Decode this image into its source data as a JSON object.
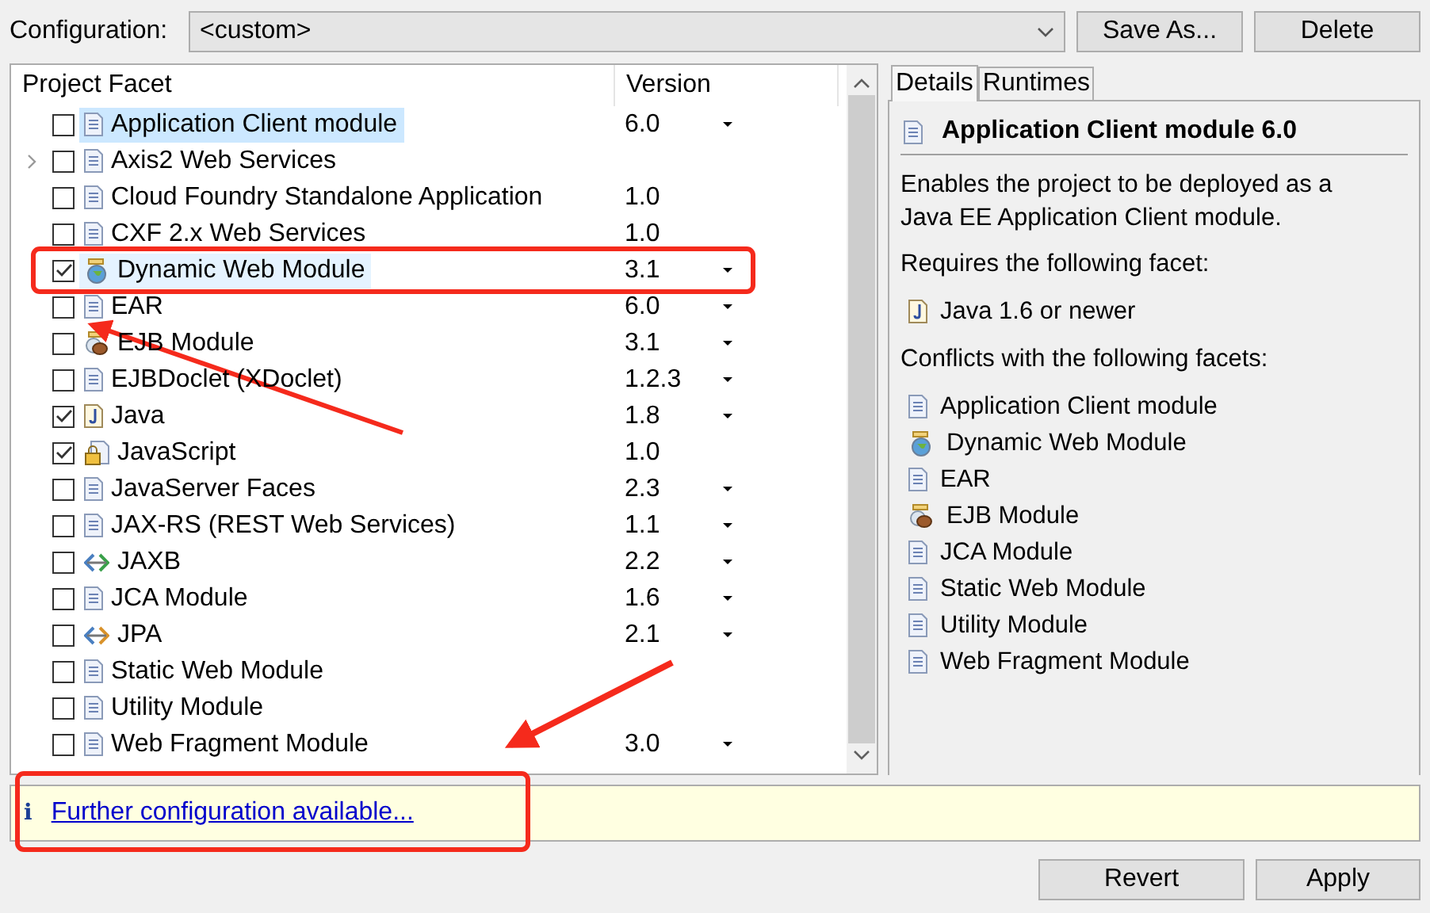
{
  "configuration": {
    "label": "Configuration:",
    "value": "<custom>"
  },
  "config_buttons": [
    "Save As...",
    "Delete"
  ],
  "table": {
    "columns": [
      "Project Facet",
      "Version"
    ],
    "rows": [
      {
        "name": "Application Client module",
        "version": "6.0",
        "kind": "document",
        "checked": false,
        "selected": true,
        "highlighted": false,
        "expandable": false,
        "has_dropdown": true
      },
      {
        "name": "Axis2 Web Services",
        "kind": "document",
        "checked": false,
        "selected": false,
        "highlighted": false,
        "expandable": true,
        "has_dropdown": false
      },
      {
        "name": "Cloud Foundry Standalone Application",
        "version": "1.0",
        "kind": "document",
        "checked": false,
        "selected": false,
        "highlighted": false,
        "expandable": false,
        "has_dropdown": false
      },
      {
        "name": "CXF 2.x Web Services",
        "version": "1.0",
        "kind": "document",
        "checked": false,
        "selected": false,
        "highlighted": false,
        "expandable": false,
        "has_dropdown": false
      },
      {
        "name": "Dynamic Web Module",
        "version": "3.1",
        "kind": "web",
        "checked": true,
        "selected": false,
        "highlighted": true,
        "expandable": false,
        "has_dropdown": true
      },
      {
        "name": "EAR",
        "version": "6.0",
        "kind": "document",
        "checked": false,
        "selected": false,
        "highlighted": false,
        "expandable": false,
        "has_dropdown": true
      },
      {
        "name": "EJB Module",
        "version": "3.1",
        "kind": "bean",
        "checked": false,
        "selected": false,
        "highlighted": false,
        "expandable": false,
        "has_dropdown": true
      },
      {
        "name": "EJBDoclet (XDoclet)",
        "version": "1.2.3",
        "kind": "document",
        "checked": false,
        "selected": false,
        "highlighted": false,
        "expandable": false,
        "has_dropdown": true
      },
      {
        "name": "Java",
        "version": "1.8",
        "kind": "java",
        "checked": true,
        "selected": false,
        "highlighted": false,
        "expandable": false,
        "has_dropdown": true
      },
      {
        "name": "JavaScript",
        "version": "1.0",
        "kind": "locked",
        "checked": true,
        "selected": false,
        "highlighted": false,
        "expandable": false,
        "has_dropdown": false
      },
      {
        "name": "JavaServer Faces",
        "version": "2.3",
        "kind": "document",
        "checked": false,
        "selected": false,
        "highlighted": false,
        "expandable": false,
        "has_dropdown": true
      },
      {
        "name": "JAX-RS (REST Web Services)",
        "version": "1.1",
        "kind": "document",
        "checked": false,
        "selected": false,
        "highlighted": false,
        "expandable": false,
        "has_dropdown": true
      },
      {
        "name": "JAXB",
        "version": "2.2",
        "kind": "binding",
        "checked": false,
        "selected": false,
        "highlighted": false,
        "expandable": false,
        "has_dropdown": true
      },
      {
        "name": "JCA Module",
        "version": "1.6",
        "kind": "document",
        "checked": false,
        "selected": false,
        "highlighted": false,
        "expandable": false,
        "has_dropdown": true
      },
      {
        "name": "JPA",
        "version": "2.1",
        "kind": "persistence",
        "checked": false,
        "selected": false,
        "highlighted": false,
        "expandable": false,
        "has_dropdown": true
      },
      {
        "name": "Static Web Module",
        "kind": "document",
        "checked": false,
        "selected": false,
        "highlighted": false,
        "expandable": false,
        "has_dropdown": false
      },
      {
        "name": "Utility Module",
        "kind": "document",
        "checked": false,
        "selected": false,
        "highlighted": false,
        "expandable": false,
        "has_dropdown": false
      },
      {
        "name": "Web Fragment Module",
        "version": "3.0",
        "kind": "document",
        "checked": false,
        "selected": false,
        "highlighted": false,
        "expandable": false,
        "has_dropdown": true
      }
    ]
  },
  "tabs": [
    {
      "label": "Details",
      "selected": true
    },
    {
      "label": "Runtimes",
      "selected": false
    }
  ],
  "details": {
    "title": {
      "text": "Application Client module 6.0",
      "kind": "document"
    },
    "description": "Enables the project to be deployed as a Java EE Application Client module.",
    "requires_label": "Requires the following facet:",
    "requires": [
      {
        "name": "Java 1.6 or newer",
        "kind": "java"
      }
    ],
    "conflicts_label": "Conflicts with the following facets:",
    "conflicts": [
      {
        "name": "Application Client module",
        "kind": "document"
      },
      {
        "name": "Dynamic Web Module",
        "kind": "web"
      },
      {
        "name": "EAR",
        "kind": "document"
      },
      {
        "name": "EJB Module",
        "kind": "bean"
      },
      {
        "name": "JCA Module",
        "kind": "document"
      },
      {
        "name": "Static Web Module",
        "kind": "document"
      },
      {
        "name": "Utility Module",
        "kind": "document"
      },
      {
        "name": "Web Fragment Module",
        "kind": "document"
      }
    ]
  },
  "info": {
    "icon": "i",
    "link": "Further configuration available..."
  },
  "buttons": [
    "Revert",
    "Apply"
  ]
}
